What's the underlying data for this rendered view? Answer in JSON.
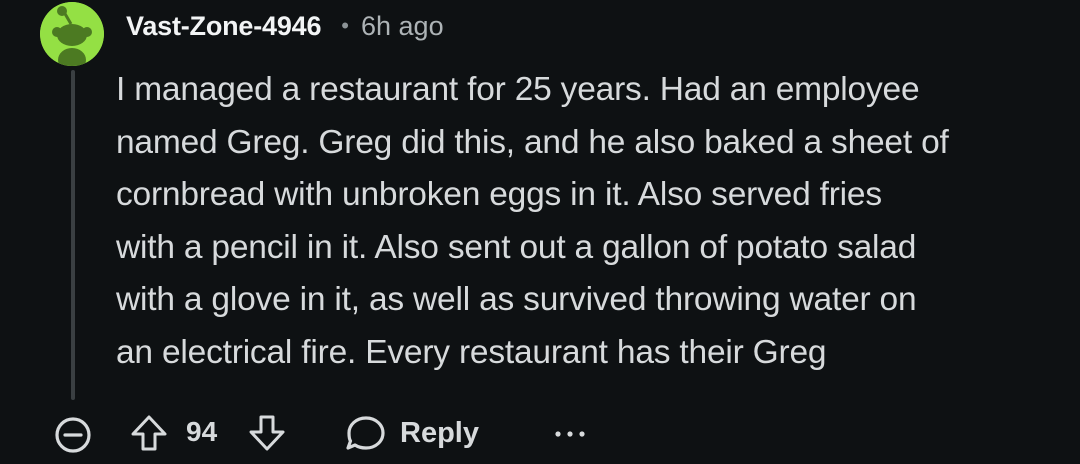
{
  "comment": {
    "username": "Vast-Zone-4946",
    "separator": "•",
    "time_ago": "6h ago",
    "text": "I managed a restaurant for 25 years. Had an employee\nnamed Greg. Greg did this, and he also baked a sheet of\ncornbread with unbroken eggs in it. Also served fries\nwith a pencil in it. Also sent out a gallon of potato salad\nwith a glove in it, as well as survived throwing water on\nan electrical fire. Every restaurant has their Greg"
  },
  "actions": {
    "score": "94",
    "reply_label": "Reply"
  },
  "icons": {
    "avatar": "snoo-avatar-icon",
    "collapse": "collapse-thread-icon",
    "upvote": "upvote-arrow-icon",
    "downvote": "downvote-arrow-icon",
    "reply": "comment-bubble-icon",
    "more": "more-options-icon"
  },
  "colors": {
    "background": "#0e1113",
    "avatar_bg": "#94e044",
    "text": "#d7dadc",
    "muted": "#adb3b6"
  }
}
